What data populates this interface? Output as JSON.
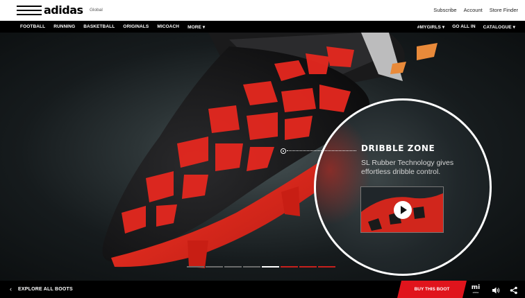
{
  "header": {
    "brand": "adidas",
    "region": "Global",
    "links": [
      "Subscribe",
      "Account",
      "Store Finder"
    ]
  },
  "nav": {
    "left": [
      "FOOTBALL",
      "RUNNING",
      "BASKETBALL",
      "ORIGINALS",
      "MICOACH",
      "MORE ▾"
    ],
    "right": [
      "#MYGIRLS ▾",
      "GO ALL IN",
      "CATALOGUE ▾"
    ]
  },
  "hotspot": {
    "title": "DRIBBLE ZONE",
    "description": "SL Rubber Technology gives effortless dribble control.",
    "video_icon": "play-icon"
  },
  "slides": {
    "count": 8,
    "active_index": 4,
    "colors": {
      "inactive": "#6b6b6b",
      "active": "#ffffff",
      "red": "#c8201d"
    }
  },
  "footer": {
    "explore_label": "EXPLORE ALL BOOTS",
    "buy_label": "BUY THIS BOOT",
    "mi_label": "mi",
    "mi_sub": "adidas",
    "accent": "#e0141c"
  },
  "colors": {
    "brand_red": "#e0141c",
    "boot_red": "#e5281f",
    "background": "#000000"
  }
}
